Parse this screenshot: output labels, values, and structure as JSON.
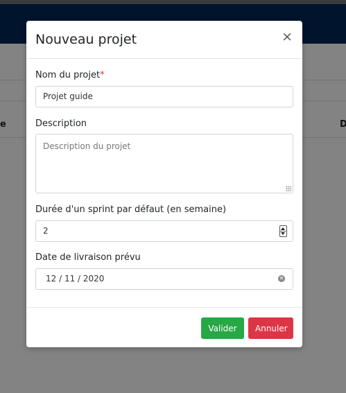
{
  "background": {
    "left_text": "e",
    "right_text": "D"
  },
  "modal": {
    "title": "Nouveau projet",
    "close": "×",
    "fields": {
      "name": {
        "label": "Nom du projet",
        "required_mark": "*",
        "value": "Projet guide"
      },
      "description": {
        "label": "Description",
        "placeholder": "Description du projet"
      },
      "sprint": {
        "label": "Durée d'un sprint par défaut (en semaine)",
        "value": "2"
      },
      "delivery": {
        "label": "Date de livraison prévu",
        "value": "12 / 11 / 2020"
      }
    },
    "buttons": {
      "validate": "Valider",
      "cancel": "Annuler"
    }
  },
  "colors": {
    "navbar": "#00142d",
    "success": "#28a745",
    "danger": "#dc3545"
  }
}
